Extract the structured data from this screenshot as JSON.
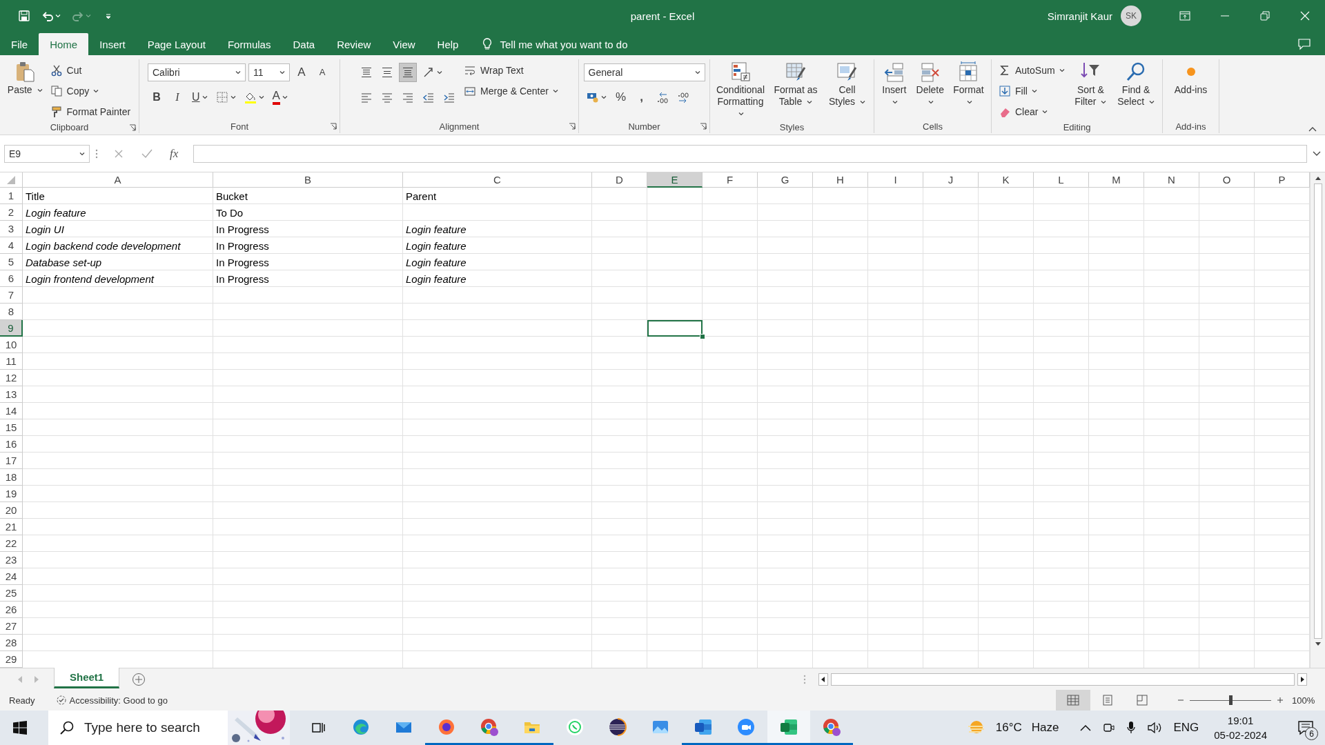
{
  "titlebar": {
    "quick_access": [
      {
        "kind": "save",
        "disabled": false
      },
      {
        "kind": "undo",
        "disabled": false
      },
      {
        "kind": "redo",
        "disabled": true
      },
      {
        "kind": "customize",
        "disabled": false
      }
    ],
    "title": "parent - Excel",
    "user": "Simranjit Kaur",
    "initials": "SK"
  },
  "ribbon_tabs": [
    {
      "label": "File",
      "selected": false
    },
    {
      "label": "Home",
      "selected": true
    },
    {
      "label": "Insert",
      "selected": false
    },
    {
      "label": "Page Layout",
      "selected": false
    },
    {
      "label": "Formulas",
      "selected": false
    },
    {
      "label": "Data",
      "selected": false
    },
    {
      "label": "Review",
      "selected": false
    },
    {
      "label": "View",
      "selected": false
    },
    {
      "label": "Help",
      "selected": false
    }
  ],
  "tell_me": "Tell me what you want to do",
  "ribbon": {
    "groups": [
      {
        "label": "Clipboard",
        "launcher": true,
        "blocks": [
          {
            "kind": "large",
            "label": "Paste",
            "dropdown": true
          },
          {
            "kind": "stack",
            "items": [
              {
                "kind": "small",
                "label": "Cut",
                "dropdown": false
              },
              {
                "kind": "small",
                "label": "Copy",
                "dropdown": true
              },
              {
                "kind": "small",
                "label": "Format Painter",
                "dropdown": false
              }
            ]
          }
        ]
      },
      {
        "label": "Font",
        "launcher": true,
        "blocks": [
          {
            "kind": "pair",
            "upper": [
              {
                "kind": "field",
                "value": "Calibri"
              },
              {
                "kind": "field",
                "value": "11"
              },
              {
                "kind": "glyph",
                "text": "A",
                "dropdown": false
              },
              {
                "kind": "glyph",
                "text": "A",
                "dropdown": false
              }
            ],
            "lower": [
              {
                "kind": "glyph",
                "text": "B",
                "dropdown": false
              },
              {
                "kind": "glyph",
                "text": "I",
                "dropdown": false
              },
              {
                "kind": "glyph",
                "text": "U",
                "dropdown": true
              },
              {
                "kind": "icon",
                "dropdown": true,
                "on": false
              },
              {
                "kind": "icon",
                "dropdown": true,
                "on": false
              },
              {
                "kind": "glyph",
                "text": "A",
                "dropdown": true
              }
            ]
          }
        ]
      },
      {
        "label": "Alignment",
        "launcher": true,
        "blocks": [
          {
            "kind": "pair",
            "upper": [
              {
                "kind": "icon",
                "dropdown": false,
                "on": false
              },
              {
                "kind": "icon",
                "dropdown": false,
                "on": false
              },
              {
                "kind": "icon",
                "dropdown": false,
                "on": true
              },
              {
                "kind": "icon",
                "dropdown": true,
                "on": false
              }
            ],
            "lower": [
              {
                "kind": "icon",
                "dropdown": false,
                "on": false
              },
              {
                "kind": "icon",
                "dropdown": false,
                "on": false
              },
              {
                "kind": "icon",
                "dropdown": false,
                "on": false
              },
              {
                "kind": "icon",
                "dropdown": false,
                "on": false
              },
              {
                "kind": "icon",
                "dropdown": false,
                "on": false
              }
            ]
          },
          {
            "kind": "stack",
            "items": [
              {
                "kind": "small",
                "label": "Wrap Text",
                "dropdown": false
              },
              {
                "kind": "small",
                "label": "Merge & Center",
                "dropdown": true
              }
            ]
          }
        ]
      },
      {
        "label": "Number",
        "launcher": true,
        "blocks": [
          {
            "kind": "pair",
            "upper": [
              {
                "kind": "field",
                "value": "General"
              }
            ],
            "lower": [
              {
                "kind": "icon",
                "dropdown": true,
                "on": false
              },
              {
                "kind": "glyph",
                "text": "%",
                "dropdown": false
              },
              {
                "kind": "glyph",
                "text": ",",
                "dropdown": false
              },
              {
                "kind": "icon",
                "dropdown": false,
                "on": false
              },
              {
                "kind": "icon",
                "dropdown": false,
                "on": false
              }
            ]
          }
        ]
      },
      {
        "label": "Styles",
        "launcher": false,
        "blocks": [
          {
            "kind": "large",
            "label": "Conditional Formatting",
            "dropdown": true
          },
          {
            "kind": "large",
            "label": "Format as Table",
            "dropdown": true
          },
          {
            "kind": "large",
            "label": "Cell Styles",
            "dropdown": true
          }
        ]
      },
      {
        "label": "Cells",
        "launcher": false,
        "blocks": [
          {
            "kind": "large",
            "label": "Insert",
            "dropdown": true
          },
          {
            "kind": "large",
            "label": "Delete",
            "dropdown": true
          },
          {
            "kind": "large",
            "label": "Format",
            "dropdown": true
          }
        ]
      },
      {
        "label": "Editing",
        "launcher": false,
        "blocks": [
          {
            "kind": "stack",
            "items": [
              {
                "kind": "small",
                "label": "AutoSum",
                "dropdown": true
              },
              {
                "kind": "small",
                "label": "Fill",
                "dropdown": true
              },
              {
                "kind": "small",
                "label": "Clear",
                "dropdown": true
              }
            ]
          },
          {
            "kind": "large",
            "label": "Sort & Filter",
            "dropdown": true
          },
          {
            "kind": "large",
            "label": "Find & Select",
            "dropdown": true
          }
        ]
      },
      {
        "label": "Add-ins",
        "launcher": false,
        "blocks": [
          {
            "kind": "large",
            "label": "Add-ins",
            "dropdown": false
          }
        ]
      }
    ]
  },
  "formula_bar": {
    "name_box": "E9",
    "function_label": "fx"
  },
  "sheet": {
    "columns": [
      {
        "label": "A",
        "selected": false
      },
      {
        "label": "B",
        "selected": false
      },
      {
        "label": "C",
        "selected": false
      },
      {
        "label": "D",
        "selected": false
      },
      {
        "label": "E",
        "selected": true
      },
      {
        "label": "F",
        "selected": false
      },
      {
        "label": "G",
        "selected": false
      },
      {
        "label": "H",
        "selected": false
      },
      {
        "label": "I",
        "selected": false
      },
      {
        "label": "J",
        "selected": false
      },
      {
        "label": "K",
        "selected": false
      },
      {
        "label": "L",
        "selected": false
      },
      {
        "label": "M",
        "selected": false
      },
      {
        "label": "N",
        "selected": false
      },
      {
        "label": "O",
        "selected": false
      },
      {
        "label": "P",
        "selected": false
      }
    ],
    "rows": [
      {
        "number": "1",
        "selected": false,
        "cells": [
          {
            "text": "Title",
            "italic": false
          },
          {
            "text": "Bucket",
            "italic": false
          },
          {
            "text": "Parent",
            "italic": false
          }
        ]
      },
      {
        "number": "2",
        "selected": false,
        "cells": [
          {
            "text": "Login feature",
            "italic": true
          },
          {
            "text": "To Do",
            "italic": false
          }
        ]
      },
      {
        "number": "3",
        "selected": false,
        "cells": [
          {
            "text": "Login UI",
            "italic": true
          },
          {
            "text": "In Progress",
            "italic": false
          },
          {
            "text": "Login feature",
            "italic": true
          }
        ]
      },
      {
        "number": "4",
        "selected": false,
        "cells": [
          {
            "text": "Login backend code development",
            "italic": true
          },
          {
            "text": "In Progress",
            "italic": false
          },
          {
            "text": "Login feature",
            "italic": true
          }
        ]
      },
      {
        "number": "5",
        "selected": false,
        "cells": [
          {
            "text": "Database set-up",
            "italic": true
          },
          {
            "text": "In Progress",
            "italic": false
          },
          {
            "text": "Login feature",
            "italic": true
          }
        ]
      },
      {
        "number": "6",
        "selected": false,
        "cells": [
          {
            "text": "Login frontend development",
            "italic": true
          },
          {
            "text": "In Progress",
            "italic": false
          },
          {
            "text": "Login feature",
            "italic": true
          }
        ]
      },
      {
        "number": "7",
        "selected": false
      },
      {
        "number": "8",
        "selected": false
      },
      {
        "number": "9",
        "selected": true
      },
      {
        "number": "10",
        "selected": false
      },
      {
        "number": "11",
        "selected": false
      },
      {
        "number": "12",
        "selected": false
      },
      {
        "number": "13",
        "selected": false
      },
      {
        "number": "14",
        "selected": false
      },
      {
        "number": "15",
        "selected": false
      },
      {
        "number": "16",
        "selected": false
      },
      {
        "number": "17",
        "selected": false
      },
      {
        "number": "18",
        "selected": false
      },
      {
        "number": "19",
        "selected": false
      },
      {
        "number": "20",
        "selected": false
      },
      {
        "number": "21",
        "selected": false
      },
      {
        "number": "22",
        "selected": false
      },
      {
        "number": "23",
        "selected": false
      },
      {
        "number": "24",
        "selected": false
      },
      {
        "number": "25",
        "selected": false
      },
      {
        "number": "26",
        "selected": false
      },
      {
        "number": "27",
        "selected": false
      },
      {
        "number": "28",
        "selected": false
      },
      {
        "number": "29",
        "selected": false
      }
    ]
  },
  "sheet_tabs": [
    {
      "label": "Sheet1",
      "selected": true
    }
  ],
  "status_bar": {
    "mode": "Ready",
    "accessibility": "Accessibility: Good to go",
    "views": [
      {
        "kind": "normal",
        "selected": true
      },
      {
        "kind": "page-layout",
        "selected": false
      },
      {
        "kind": "page-break",
        "selected": false
      }
    ],
    "zoom": {
      "level": 0.5,
      "reading": "100%"
    }
  },
  "taskbar": {
    "search": {
      "placeholder": "Type here to search"
    },
    "apps": [
      {
        "kind": "edge",
        "open": false,
        "active": false
      },
      {
        "kind": "mail",
        "open": false,
        "active": false
      },
      {
        "kind": "firefox",
        "open": true,
        "active": false
      },
      {
        "kind": "chrome",
        "open": true,
        "active": false
      },
      {
        "kind": "explorer",
        "open": true,
        "active": false
      },
      {
        "kind": "whatsapp",
        "open": false,
        "active": false
      },
      {
        "kind": "eclipse",
        "open": false,
        "active": false
      },
      {
        "kind": "photos",
        "open": false,
        "active": false
      },
      {
        "kind": "word",
        "open": true,
        "active": false
      },
      {
        "kind": "zoom",
        "open": true,
        "active": false
      },
      {
        "kind": "excel",
        "open": true,
        "active": true
      },
      {
        "kind": "chrome",
        "open": true,
        "active": false
      }
    ],
    "weather": {
      "temperature": "16°C",
      "condition": "Haze"
    },
    "language": "ENG",
    "time": "19:01",
    "date": "05-02-2024",
    "notifications": "6"
  }
}
